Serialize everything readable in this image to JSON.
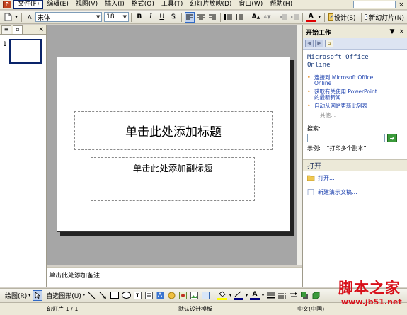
{
  "menubar": {
    "items": [
      {
        "label": "文件(F)",
        "active": true
      },
      {
        "label": "编辑(E)"
      },
      {
        "label": "视图(V)"
      },
      {
        "label": "插入(I)"
      },
      {
        "label": "格式(O)"
      },
      {
        "label": "工具(T)"
      },
      {
        "label": "幻灯片放映(D)"
      },
      {
        "label": "窗口(W)"
      },
      {
        "label": "帮助(H)"
      }
    ],
    "close_doc": "×"
  },
  "toolbar": {
    "font_name": "宋体",
    "font_size": "18",
    "bold": "B",
    "italic": "I",
    "underline": "U",
    "shadow": "S",
    "design_label": "设计(S)",
    "new_slide_label": "新幻灯片(N)"
  },
  "left_pane": {
    "slide_number": "1",
    "close": "×"
  },
  "slide": {
    "title_placeholder": "单击此处添加标题",
    "subtitle_placeholder": "单击此处添加副标题"
  },
  "notes": {
    "placeholder": "单击此处添加备注"
  },
  "task_pane": {
    "title": "开始工作",
    "office_title_line1": "Microsoft Office",
    "office_title_line2": "Online",
    "links": [
      {
        "line1": "连接到 Microsoft Office",
        "line2": "Online"
      },
      {
        "line1": "获取有关使用 PowerPoint",
        "line2": "的最新新闻"
      },
      {
        "line1": "自动从网站更新此列表",
        "line2": ""
      }
    ],
    "more": "其他...",
    "search_label": "搜索:",
    "example_label": "示例:",
    "example_text": "“打印多个副本”",
    "open_section": "打开",
    "open_link": "打开...",
    "new_presentation_link": "新建演示文稿..."
  },
  "drawbar": {
    "draw_label": "绘图(R)",
    "autoshapes_label": "自选图形(U)"
  },
  "statusbar": {
    "slide_info": "幻灯片 1 / 1",
    "template": "默认设计模板",
    "language": "中文(中国)"
  },
  "watermark": {
    "line1": "脚本之家",
    "line2": "www.jb51.net"
  }
}
